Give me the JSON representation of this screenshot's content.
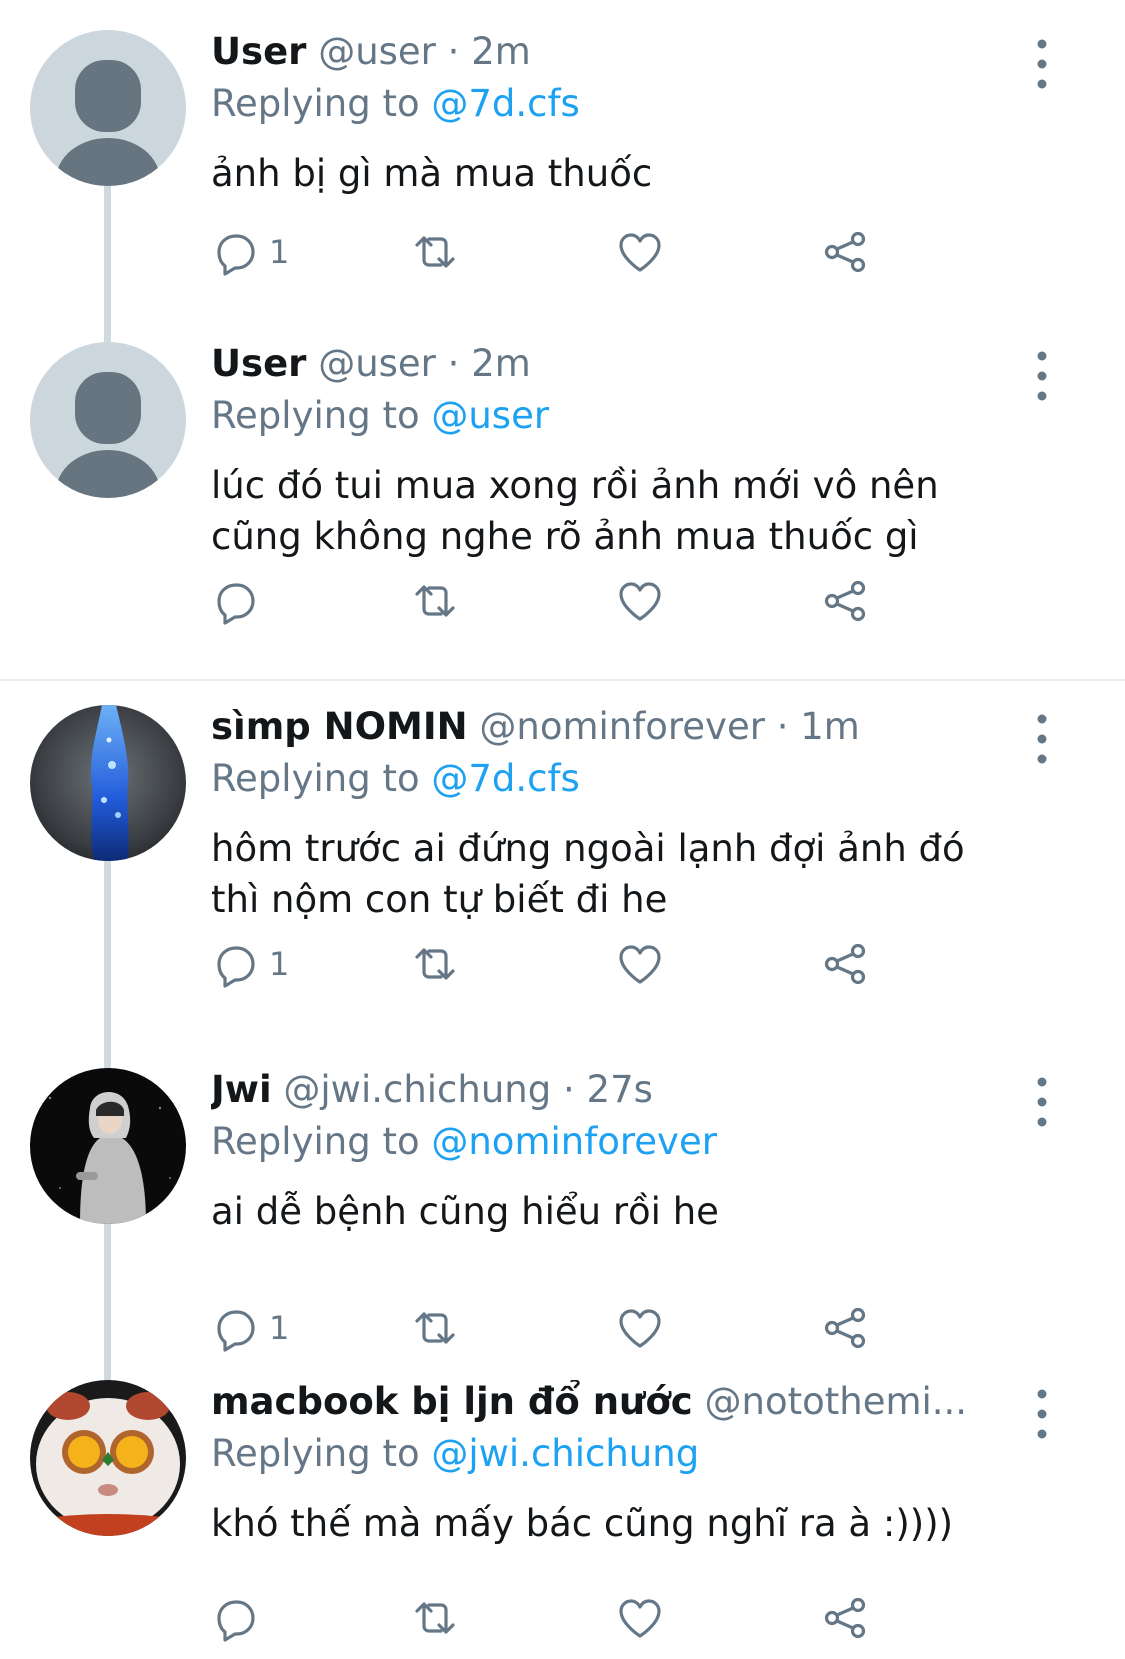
{
  "tweets": [
    {
      "name": "User",
      "handle": "@user",
      "dot": " · ",
      "time": "2m",
      "replying_label": "Replying to ",
      "replying_to": "@7d.cfs",
      "text": "ảnh bị gì mà mua thuốc",
      "reply_count": "1",
      "avatar": "default-avatar"
    },
    {
      "name": "User",
      "handle": "@user",
      "dot": " · ",
      "time": "2m",
      "replying_label": "Replying to ",
      "replying_to": "@user",
      "text": "lúc đó tui mua xong rồi ảnh mới vô nên cũng không nghe rõ ảnh mua thuốc gì",
      "reply_count": "",
      "avatar": "default-avatar"
    },
    {
      "name": "sìmp NOMIN",
      "handle": "@nominforever",
      "dot": " · ",
      "time": "1m",
      "replying_label": "Replying to ",
      "replying_to": "@7d.cfs",
      "text": "hôm trước ai đứng ngoài lạnh đợi ảnh đó thì nộm con tự biết đi he",
      "reply_count": "1",
      "avatar": "blue-galaxy-photo"
    },
    {
      "name": "Jwi",
      "handle": "@jwi.chichung",
      "dot": " · ",
      "time": "27s",
      "replying_label": "Replying to ",
      "replying_to": "@nominforever",
      "text": "ai dễ bệnh cũng hiểu rồi he",
      "reply_count": "1",
      "avatar": "person-hoodie-photo"
    },
    {
      "name": "macbook bị ljn đổ nước",
      "handle": "@notothemi...",
      "dot": "",
      "time": "",
      "replying_label": "Replying to ",
      "replying_to": "@jwi.chichung",
      "text": "khó thế mà mấy bác cũng nghĩ ra à :))))",
      "reply_count": "",
      "avatar": "plush-face-photo"
    }
  ],
  "icons": {
    "reply": "reply-bubble-icon",
    "retweet": "retweet-icon",
    "like": "heart-icon",
    "share": "share-icon",
    "more": "vertical-dots-icon"
  },
  "colors": {
    "accent": "#1da1f2",
    "secondary_text": "#657786",
    "thread_line": "#cfd9de",
    "divider": "#e6ecf0"
  }
}
